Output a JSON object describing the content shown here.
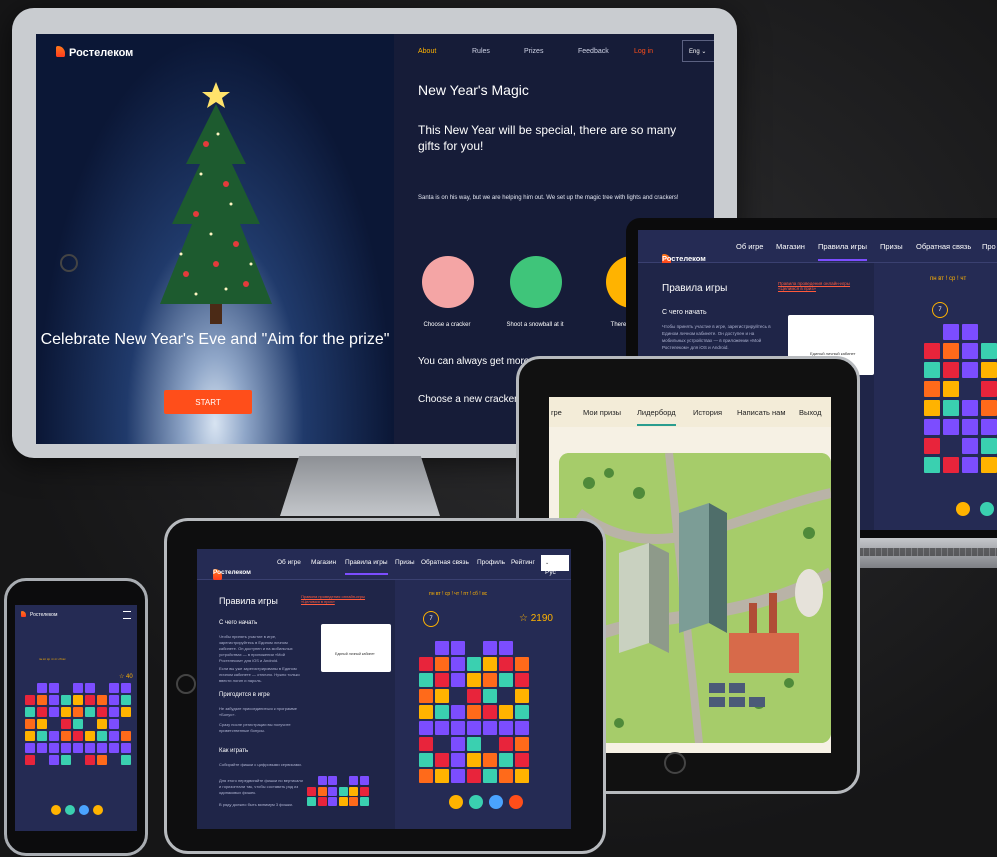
{
  "monitor": {
    "brand": "Ростелеком",
    "nav": [
      "About",
      "Rules",
      "Prizes",
      "Feedback"
    ],
    "login": "Log in",
    "lang": "Eng",
    "hero_title": "Celebrate New Year's Eve and \"Aim for the prize\"",
    "start": "START",
    "heading": "New Year's Magic",
    "subheading": "This New Year will be special, there are so many gifts for you!",
    "body": "Santa is on his way, but we are helping him out. We set up the magic tree with lights and crackers!",
    "steps": [
      "Choose a cracker",
      "Shoot a snowball at it",
      "There a ev"
    ],
    "more": "You can always get more",
    "choose": "Choose a new cracker a"
  },
  "laptop": {
    "brand": "Ростелеком",
    "nav": [
      "Об игре",
      "Магазин",
      "Правила игры",
      "Призы",
      "Обратная связь",
      "Про"
    ],
    "title": "Правила игры",
    "link": "Правила проведения онлайн-игры «Целимся в приз»",
    "section": "С чего начать",
    "text": "Чтобы принять участие в игре, зарегистрируйтесь в Едином личном кабинете. Он доступен и на мобильных устройствах — в приложении «Мой Ростелеком» для iOS и Android.",
    "card_label": "Единый личный кабинет",
    "days": "пн  вт !  ср !  чт",
    "moves": "7"
  },
  "tablet_right": {
    "nav": [
      "rpe",
      "Мои призы",
      "Лидерборд",
      "История",
      "Написать нам",
      "Выход"
    ]
  },
  "tablet_left": {
    "brand": "Ростелеком",
    "nav": [
      "Об игре",
      "Магазин",
      "Правила игры",
      "Призы",
      "Обратная связь",
      "Профиль",
      "Рейтинг"
    ],
    "lang": "Рус",
    "title": "Правила игры",
    "link": "Правила проведения онлайн-игры «Целимся в приз»",
    "s1": "С чего начать",
    "p1": "Чтобы принять участие в игре, зарегистрируйтесь в Едином личном кабинете. Он доступен и на мобильных устройствах — в приложении «Мой Ростелеком» для iOS и Android.",
    "p2": "Если вы уже зарегистрированы в Едином личном кабинете — отлично. Нужно только ввести логин и пароль.",
    "s2": "Пригодится в игре",
    "p3": "Не забудьте присоединиться к программе «Бонус».",
    "p4": "Сразу после регистрации вы получите приветственные бонусы.",
    "s3": "Как играть",
    "p5": "Собирайте фишки с цифровыми сервисами.",
    "p6": "Для этого передвигайте фишки по вертикали и горизонтали так, чтобы составить ряд из одинаковых фишек.",
    "p7": "В ряду должно быть минимум 3 фишки.",
    "card_label": "Единый личный кабинет",
    "days": "пн  вт !  ср !  чт !  пт !  сб !  вс",
    "moves": "7",
    "score": "☆ 2190"
  },
  "phone": {
    "brand": "Ростелеком",
    "days": "пн  вт  ср  чт  пт  сб  вс",
    "score": "☆ 40"
  },
  "colors": {
    "accent": "#ff4e1a",
    "gold": "#ffb300",
    "navy": "#252b54",
    "purple": "#7c4dff",
    "teal": "#3ad0b0",
    "red": "#e8243b"
  }
}
